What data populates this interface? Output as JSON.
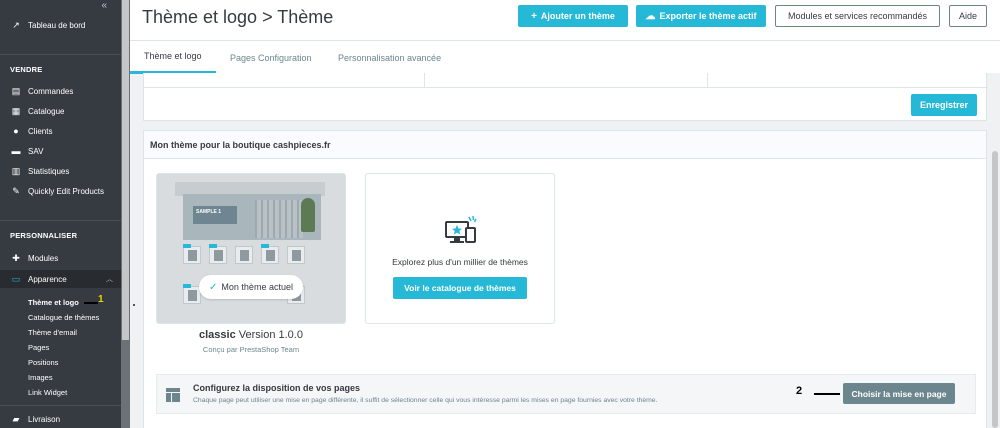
{
  "sidebar": {
    "dashboard": "Tableau de bord",
    "sections": [
      {
        "title": "VENDRE",
        "items": [
          "Commandes",
          "Catalogue",
          "Clients",
          "SAV",
          "Statistiques",
          "Quickly Edit Products"
        ]
      },
      {
        "title": "PERSONNALISER",
        "items": [
          "Modules",
          "Apparence"
        ]
      }
    ],
    "submenu": [
      "Thème et logo",
      "Catalogue de thèmes",
      "Thème d'email",
      "Pages",
      "Positions",
      "Images",
      "Link Widget"
    ],
    "bottom_item": "Livraison",
    "annotation_1": "1"
  },
  "header": {
    "title": "Thème et logo > Thème",
    "add_theme": "Ajouter un thème",
    "export_theme": "Exporter le thème actif",
    "modules": "Modules et services recommandés",
    "help": "Aide"
  },
  "tabs": [
    "Thème et logo",
    "Pages Configuration",
    "Personnalisation avancée"
  ],
  "save_label": "Enregistrer",
  "theme_section": {
    "heading": "Mon thème pour la boutique cashpieces.fr",
    "current_badge": "Mon thème actuel",
    "thumbnail_banner": "SAMPLE 1",
    "theme_name": "classic",
    "theme_version": "Version 1.0.0",
    "theme_author": "Conçu par PrestaShop Team",
    "explore_text": "Explorez plus d'un millier de thèmes",
    "explore_button": "Voir le catalogue de thèmes"
  },
  "layout_section": {
    "title": "Configurez la disposition de vos pages",
    "description": "Chaque page peut utiliser une mise en page différente, il suffit de sélectionner celle qui vous intéresse parmi les mises en page fournies avec votre thème.",
    "button": "Choisir la mise en page",
    "annotation_2": "2"
  },
  "colors": {
    "accent": "#25b9d7",
    "sidebar": "#363a41",
    "secondary_button": "#6c868e"
  }
}
